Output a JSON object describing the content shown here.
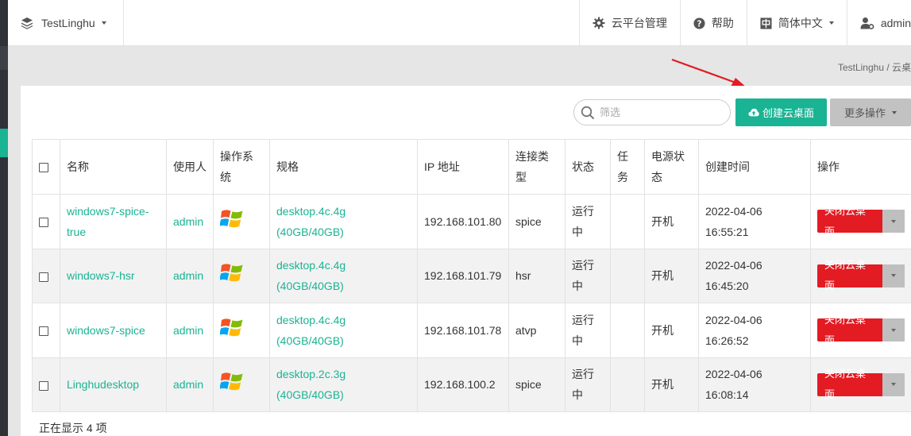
{
  "topbar": {
    "project": "TestLinghu",
    "items": [
      {
        "label": "云平台管理",
        "icon": "gear-icon"
      },
      {
        "label": "帮助",
        "icon": "help-icon"
      },
      {
        "label": "简体中文",
        "icon": "language-icon"
      },
      {
        "label": "admin",
        "icon": "user-settings-icon"
      }
    ]
  },
  "breadcrumb": "TestLinghu / 云桌",
  "toolbar": {
    "search_placeholder": "筛选",
    "create_label": "创建云桌面",
    "more_label": "更多操作"
  },
  "table": {
    "headers": {
      "name": "名称",
      "user": "使用人",
      "os": "操作系统",
      "flavor": "规格",
      "ip": "IP 地址",
      "conn": "连接类型",
      "status": "状态",
      "task": "任务",
      "power": "电源状态",
      "created": "创建时间",
      "action": "操作"
    },
    "rows": [
      {
        "name": "windows7-spice-true",
        "user": "admin",
        "os": "windows-logo-icon",
        "flavor_name": "desktop.4c.4g",
        "flavor_disk": "(40GB/40GB)",
        "ip": "192.168.101.80",
        "conn": "spice",
        "status": "运行中",
        "task": "",
        "power": "开机",
        "date": "2022-04-06",
        "time": "16:55:21",
        "action": "关闭云桌面"
      },
      {
        "name": "windows7-hsr",
        "user": "admin",
        "os": "windows-logo-icon",
        "flavor_name": "desktop.4c.4g",
        "flavor_disk": "(40GB/40GB)",
        "ip": "192.168.101.79",
        "conn": "hsr",
        "status": "运行中",
        "task": "",
        "power": "开机",
        "date": "2022-04-06",
        "time": "16:45:20",
        "action": "关闭云桌面"
      },
      {
        "name": "windows7-spice",
        "user": "admin",
        "os": "windows-logo-icon",
        "flavor_name": "desktop.4c.4g",
        "flavor_disk": "(40GB/40GB)",
        "ip": "192.168.101.78",
        "conn": "atvp",
        "status": "运行中",
        "task": "",
        "power": "开机",
        "date": "2022-04-06",
        "time": "16:26:52",
        "action": "关闭云桌面"
      },
      {
        "name": "Linghudesktop",
        "user": "admin",
        "os": "windows-logo-icon",
        "flavor_name": "desktop.2c.3g",
        "flavor_disk": "(40GB/40GB)",
        "ip": "192.168.100.2",
        "conn": "spice",
        "status": "运行中",
        "task": "",
        "power": "开机",
        "date": "2022-04-06",
        "time": "16:08:14",
        "action": "关闭云桌面"
      }
    ]
  },
  "footer": "正在显示 4 项",
  "colors": {
    "accent": "#1ab394",
    "danger": "#e31b23",
    "annotation": "#e31b23"
  }
}
